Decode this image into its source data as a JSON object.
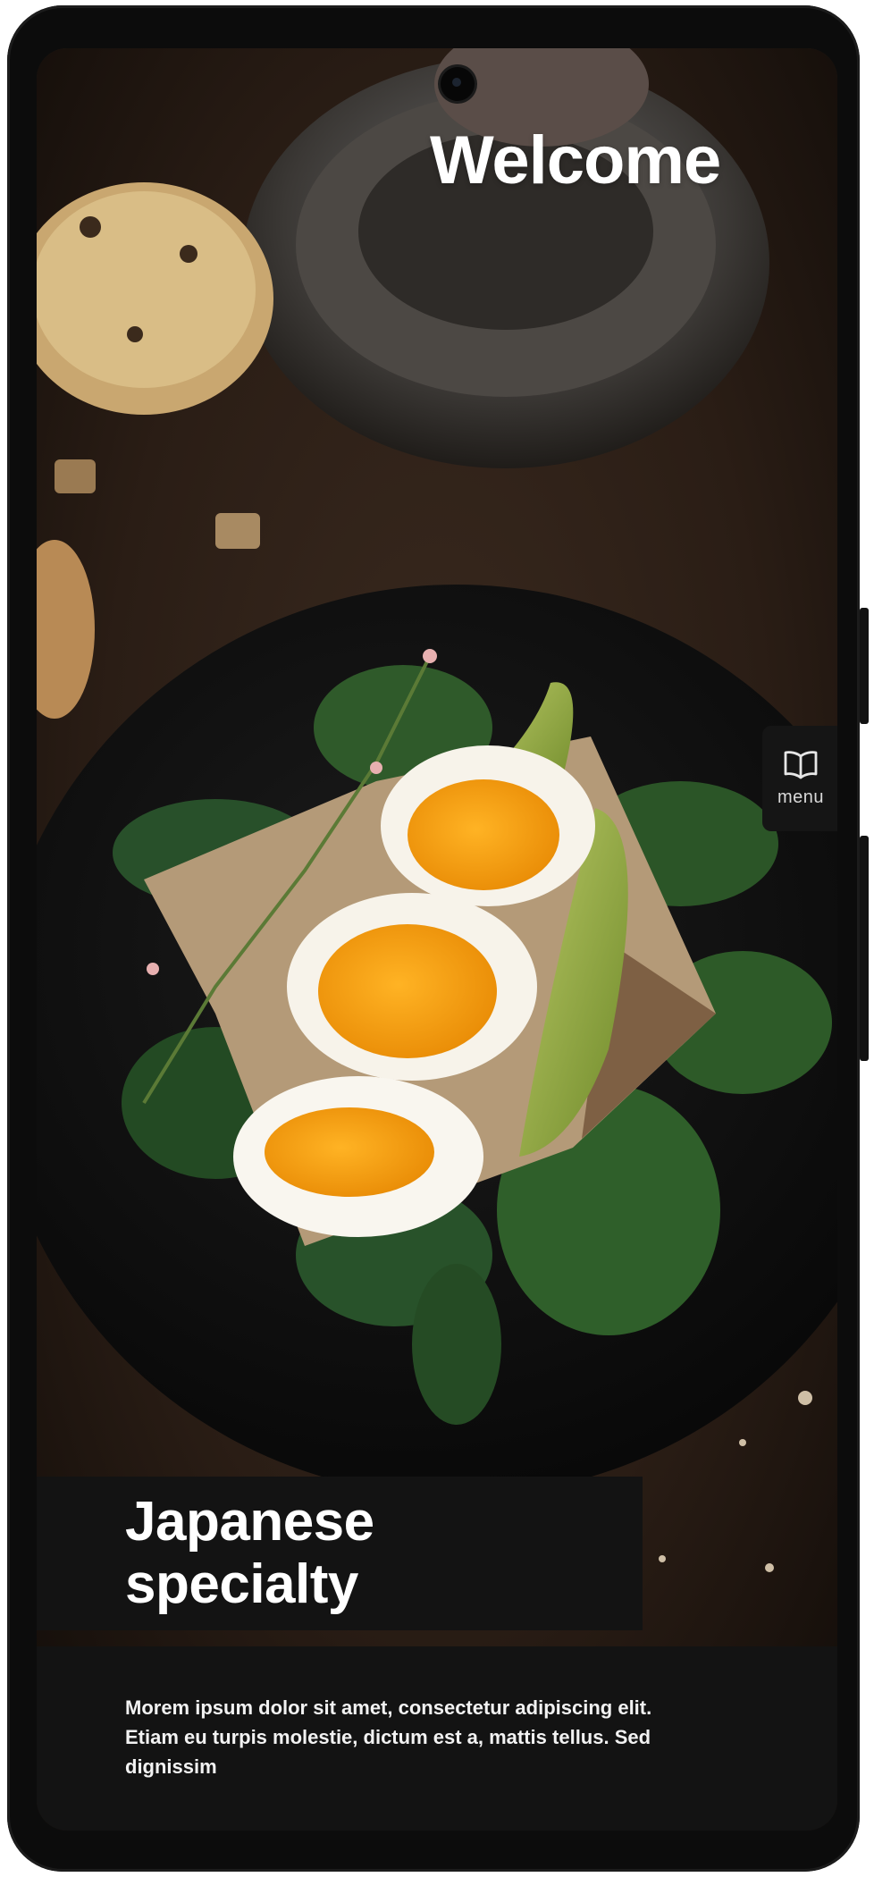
{
  "header": {
    "welcome": "Welcome"
  },
  "side_menu": {
    "label": "menu",
    "icon": "open-book-icon"
  },
  "hero": {
    "title_line1": "Japanese",
    "title_line2": "specialty",
    "description": "Morem ipsum dolor sit amet, consectetur adipiscing elit. Etiam eu turpis molestie, dictum est a, mattis tellus. Sed dignissim"
  },
  "colors": {
    "panel_background": "#131313",
    "text_primary": "#ffffff",
    "phone_frame": "#0c0c0c"
  }
}
